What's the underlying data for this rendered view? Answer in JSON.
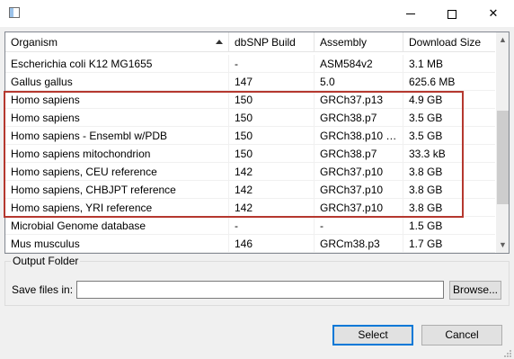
{
  "window": {
    "minimize_glyph": "",
    "close_glyph": "✕"
  },
  "table": {
    "columns": [
      {
        "label": "Organism",
        "sorted": "ascending"
      },
      {
        "label": "dbSNP Build"
      },
      {
        "label": "Assembly"
      },
      {
        "label": "Download Size"
      }
    ],
    "rows": [
      {
        "organism": "Escherichia coli K12 MG1655",
        "dbsnp": "-",
        "assembly": "ASM584v2",
        "size": "3.1 MB"
      },
      {
        "organism": "Gallus gallus",
        "dbsnp": "147",
        "assembly": "5.0",
        "size": "625.6 MB"
      },
      {
        "organism": "Homo sapiens",
        "dbsnp": "150",
        "assembly": "GRCh37.p13",
        "size": "4.9 GB"
      },
      {
        "organism": "Homo sapiens",
        "dbsnp": "150",
        "assembly": "GRCh38.p7",
        "size": "3.5 GB"
      },
      {
        "organism": "Homo sapiens - Ensembl w/PDB",
        "dbsnp": "150",
        "assembly": "GRCh38.p10 + ...",
        "size": "3.5 GB"
      },
      {
        "organism": "Homo sapiens mitochondrion",
        "dbsnp": "150",
        "assembly": "GRCh38.p7",
        "size": "33.3 kB"
      },
      {
        "organism": "Homo sapiens, CEU reference",
        "dbsnp": "142",
        "assembly": "GRCh37.p10",
        "size": "3.8 GB"
      },
      {
        "organism": "Homo sapiens, CHBJPT reference",
        "dbsnp": "142",
        "assembly": "GRCh37.p10",
        "size": "3.8 GB"
      },
      {
        "organism": "Homo sapiens, YRI reference",
        "dbsnp": "142",
        "assembly": "GRCh37.p10",
        "size": "3.8 GB"
      },
      {
        "organism": "Microbial Genome database",
        "dbsnp": "-",
        "assembly": "-",
        "size": "1.5 GB"
      },
      {
        "organism": "Mus musculus",
        "dbsnp": "146",
        "assembly": "GRCm38.p3",
        "size": "1.7 GB"
      }
    ],
    "scroll_up_glyph": "▲",
    "scroll_down_glyph": "▼"
  },
  "output": {
    "group_label": "Output Folder",
    "save_label": "Save files in:",
    "path_value": "",
    "browse_label": "Browse..."
  },
  "actions": {
    "select_label": "Select",
    "cancel_label": "Cancel"
  },
  "colors": {
    "highlight_border": "#b5382f",
    "primary_button_border": "#0078d7"
  }
}
